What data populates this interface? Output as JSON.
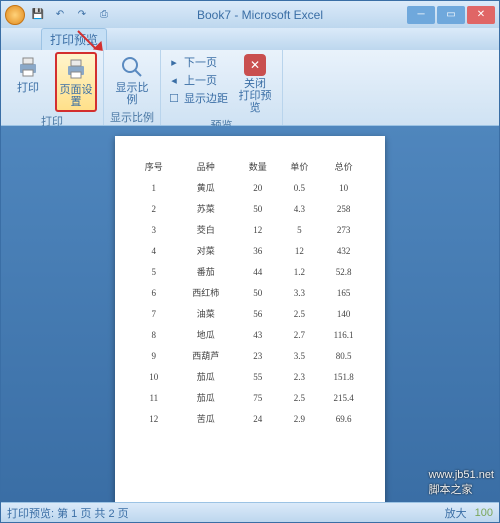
{
  "window": {
    "title": "Book7 - Microsoft Excel",
    "qat": {
      "save": "💾",
      "undo": "↶",
      "redo": "↷",
      "print": "⎙"
    }
  },
  "tab": {
    "label": "打印预览"
  },
  "ribbon": {
    "groups": {
      "print": {
        "label": "打印",
        "print_btn": "打印",
        "page_setup_btn": "页面设置"
      },
      "zoom": {
        "label": "显示比例",
        "zoom_btn": "显示比例"
      },
      "preview": {
        "label": "预览",
        "next_page": "下一页",
        "prev_page": "上一页",
        "show_margins": "显示边距",
        "close_btn": "关闭\n打印预览"
      }
    }
  },
  "table": {
    "headers": [
      "序号",
      "品种",
      "数量",
      "单价",
      "总价"
    ],
    "rows": [
      [
        "1",
        "黄瓜",
        "20",
        "0.5",
        "10"
      ],
      [
        "2",
        "苏菜",
        "50",
        "4.3",
        "258"
      ],
      [
        "3",
        "茭白",
        "12",
        "5",
        "273"
      ],
      [
        "4",
        "对菜",
        "36",
        "12",
        "432"
      ],
      [
        "5",
        "番茄",
        "44",
        "1.2",
        "52.8"
      ],
      [
        "6",
        "西红柿",
        "50",
        "3.3",
        "165"
      ],
      [
        "7",
        "油菜",
        "56",
        "2.5",
        "140"
      ],
      [
        "8",
        "地瓜",
        "43",
        "2.7",
        "116.1"
      ],
      [
        "9",
        "西葫芦",
        "23",
        "3.5",
        "80.5"
      ],
      [
        "10",
        "茄瓜",
        "55",
        "2.3",
        "151.8"
      ],
      [
        "11",
        "茄瓜",
        "75",
        "2.5",
        "215.4"
      ],
      [
        "12",
        "苦瓜",
        "24",
        "2.9",
        "69.6"
      ]
    ]
  },
  "statusbar": {
    "page_info": "打印预览: 第 1 页  共 2 页",
    "zoom_label": "放大",
    "zoom_value": "100"
  },
  "watermark": "www.jb51.net\n脚本之家"
}
